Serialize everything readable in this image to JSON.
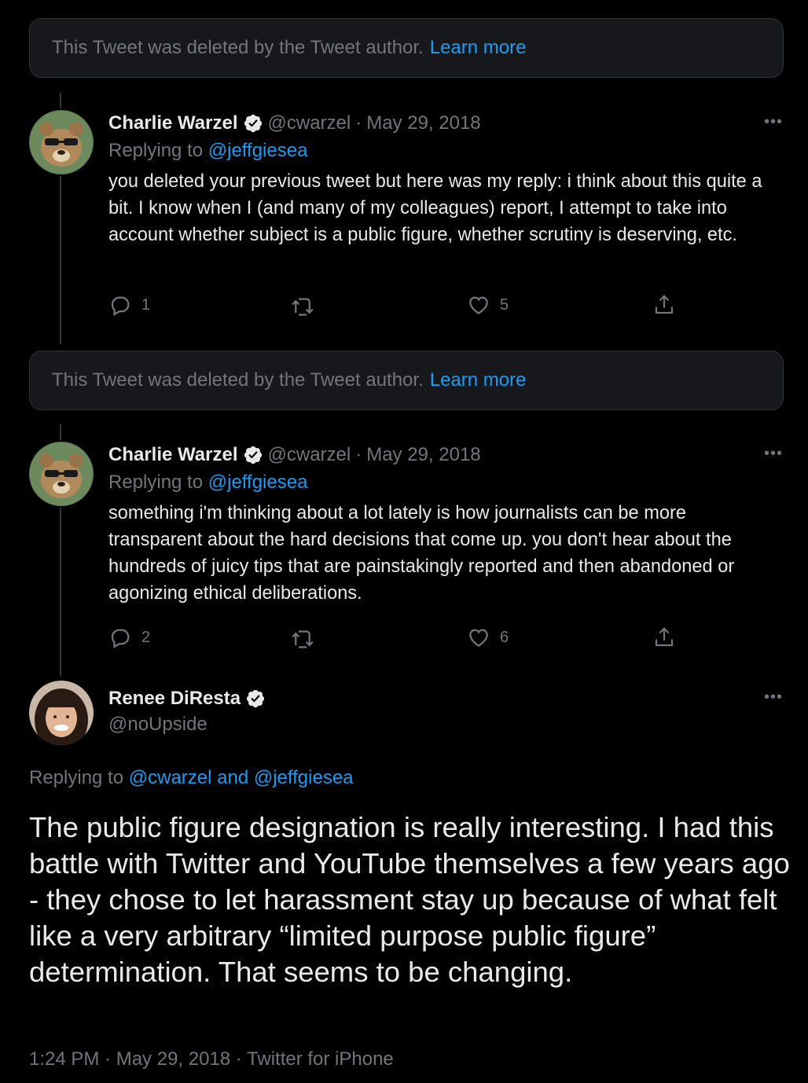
{
  "deleted_notice": {
    "text": "This Tweet was deleted by the Tweet author.",
    "link": "Learn more"
  },
  "tweets": [
    {
      "name": "Charlie Warzel",
      "handle": "@cwarzel",
      "separator": "·",
      "date": "May 29, 2018",
      "replying_label": "Replying to",
      "replying_to": "@jeffgiesea",
      "text": "you deleted your previous tweet but here was my reply: i think about this quite a bit. I know when I (and many of my colleagues) report, I attempt to take into account whether subject is a public figure, whether scrutiny is deserving, etc.",
      "replies": "1",
      "likes": "5"
    },
    {
      "name": "Charlie Warzel",
      "handle": "@cwarzel",
      "separator": "·",
      "date": "May 29, 2018",
      "replying_label": "Replying to",
      "replying_to": "@jeffgiesea",
      "text": "something i'm thinking about a lot lately is how journalists can be more transparent about the hard decisions that come up. you don't hear about the hundreds of juicy tips that are painstakingly reported and then abandoned or agonizing ethical deliberations.",
      "replies": "2",
      "likes": "6"
    }
  ],
  "main_tweet": {
    "name": "Renee DiResta",
    "handle": "@noUpside",
    "replying_label": "Replying to",
    "replying_to": "@cwarzel and @jeffgiesea",
    "text": "The public figure designation is really interesting. I had this battle with Twitter and YouTube themselves a few years ago - they chose to let harassment stay up because of what felt like a very arbitrary “limited purpose public figure” determination. That seems to be changing.",
    "meta": "1:24 PM · May 29, 2018 · Twitter for iPhone"
  },
  "icons": {
    "verified": "verified-badge-icon",
    "more": "more-options-icon",
    "reply": "reply-icon",
    "retweet": "retweet-icon",
    "like": "like-icon",
    "share": "share-icon"
  },
  "colors": {
    "background": "#000000",
    "text": "#e7e9ea",
    "secondary": "#71767b",
    "accent": "#1d9bf0",
    "card": "#16181c"
  }
}
